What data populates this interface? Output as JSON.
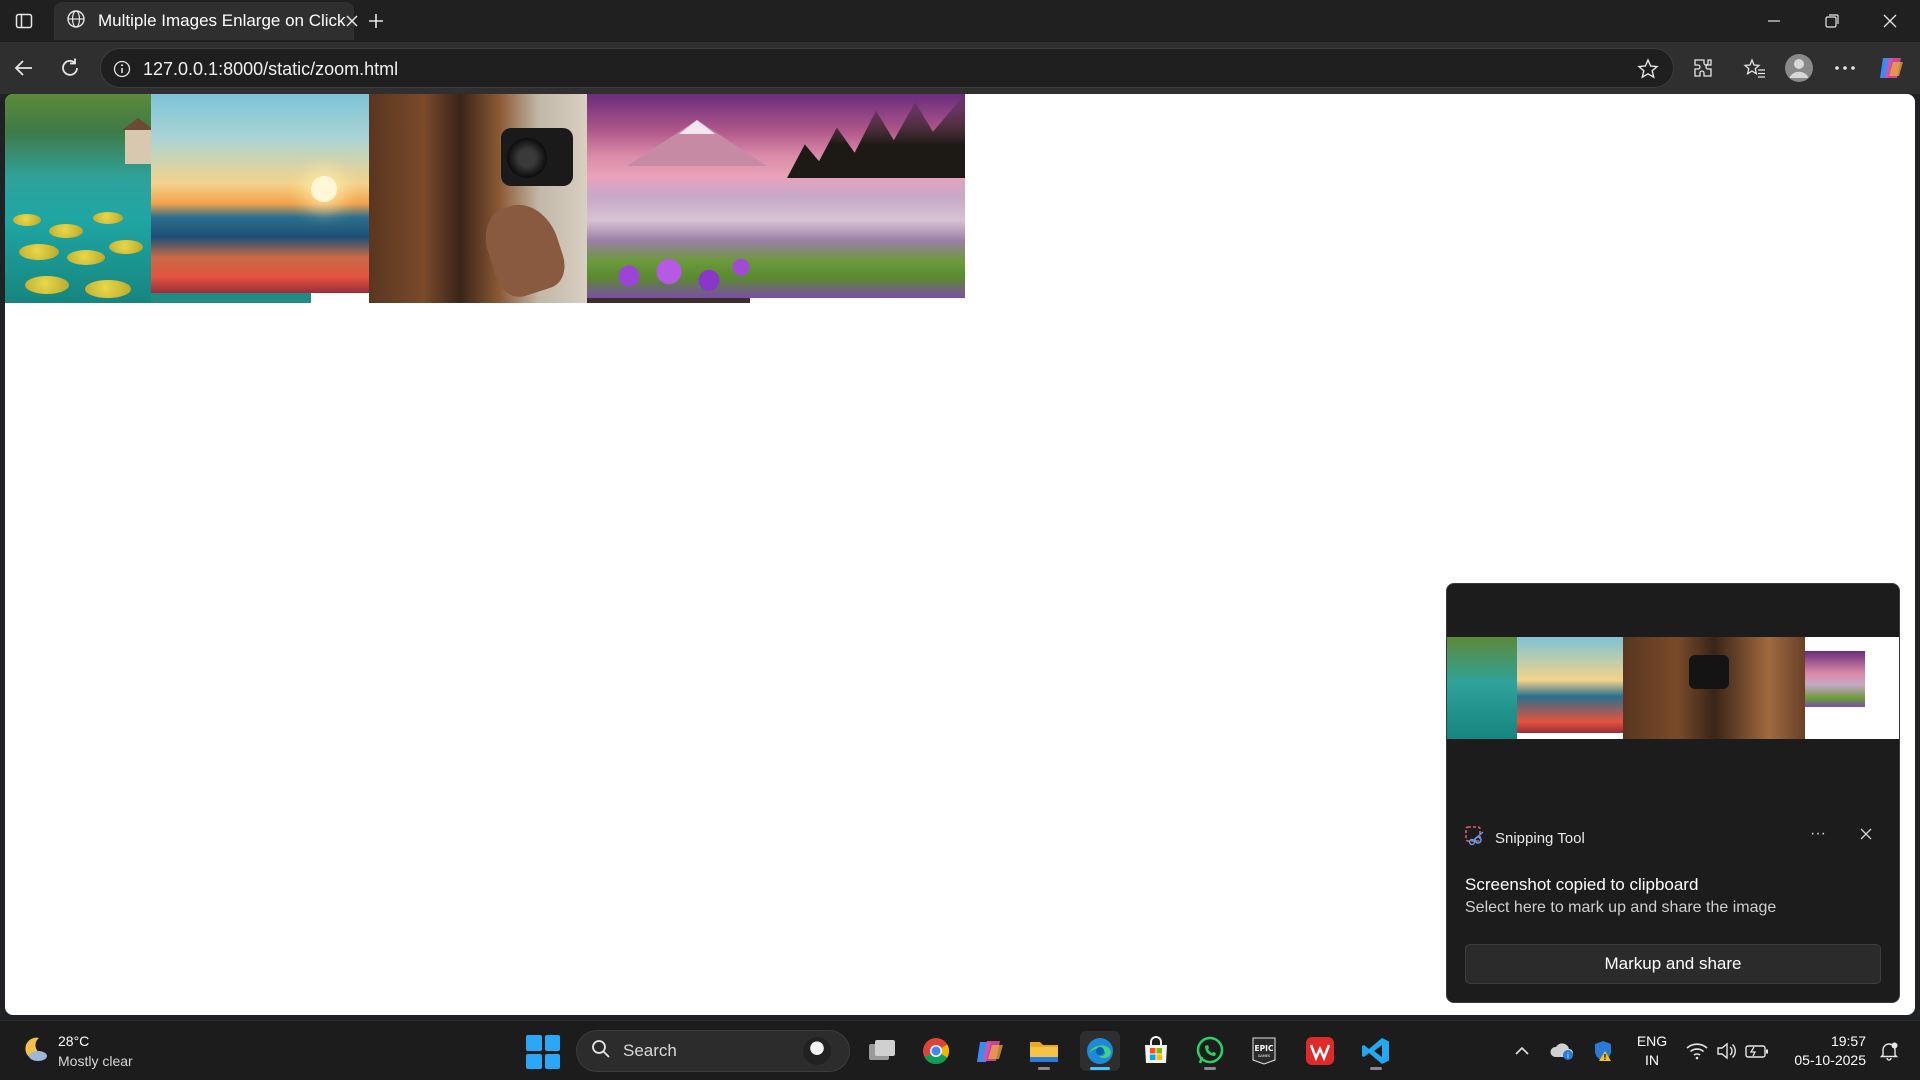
{
  "browser": {
    "tab_title": "Multiple Images Enlarge on Click",
    "url": "127.0.0.1:8000/static/zoom.html",
    "icons": [
      "sidebar-icon",
      "globe-icon",
      "close-icon",
      "plus-icon",
      "minimize-icon",
      "restore-icon",
      "close-window-icon",
      "back-icon",
      "refresh-icon",
      "info-icon",
      "star-icon",
      "extensions-icon",
      "favorites-icon",
      "profile-icon",
      "more-icon",
      "copilot-icon"
    ]
  },
  "page": {
    "images": [
      {
        "alt": "lily pads on a lake"
      },
      {
        "alt": "ocean sunset"
      },
      {
        "alt": "photographer with camera"
      },
      {
        "alt": "mountain lake with flowers"
      }
    ]
  },
  "notification": {
    "app_name": "Snipping Tool",
    "more_label": "···",
    "title": "Screenshot copied to clipboard",
    "body": "Select here to mark up and share the image",
    "button_label": "Markup and share"
  },
  "taskbar": {
    "weather_temp": "28°C",
    "weather_condition": "Mostly clear",
    "search_placeholder": "Search",
    "language_line1": "ENG",
    "language_line2": "IN",
    "time": "19:57",
    "date": "05-10-2025",
    "apps": [
      "task-view",
      "chrome",
      "copilot",
      "file-explorer",
      "edge",
      "microsoft-store",
      "whatsapp",
      "epic-games",
      "wps-office",
      "vscode"
    ],
    "accent_color": "#4cc2ff"
  }
}
